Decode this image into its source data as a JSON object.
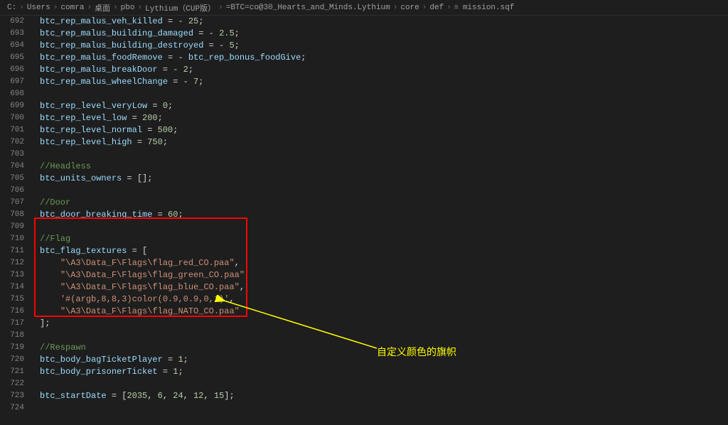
{
  "breadcrumb": {
    "items": [
      "C:",
      "Users",
      "comra",
      "桌面",
      "pbo",
      "Lythium（CUP版）",
      "=BTC=co@30_Hearts_and_Minds.Lythium",
      "core",
      "def",
      "mission.sqf"
    ],
    "file_icon": "≡"
  },
  "lines": [
    {
      "n": 692,
      "tokens": [
        {
          "t": "var",
          "v": "btc_rep_malus_veh_killed"
        },
        {
          "t": "op",
          "v": " = "
        },
        {
          "t": "op",
          "v": "- "
        },
        {
          "t": "num",
          "v": "25"
        },
        {
          "t": "punc",
          "v": ";"
        }
      ]
    },
    {
      "n": 693,
      "tokens": [
        {
          "t": "var",
          "v": "btc_rep_malus_building_damaged"
        },
        {
          "t": "op",
          "v": " = "
        },
        {
          "t": "op",
          "v": "- "
        },
        {
          "t": "num",
          "v": "2.5"
        },
        {
          "t": "punc",
          "v": ";"
        }
      ]
    },
    {
      "n": 694,
      "tokens": [
        {
          "t": "var",
          "v": "btc_rep_malus_building_destroyed"
        },
        {
          "t": "op",
          "v": " = "
        },
        {
          "t": "op",
          "v": "- "
        },
        {
          "t": "num",
          "v": "5"
        },
        {
          "t": "punc",
          "v": ";"
        }
      ]
    },
    {
      "n": 695,
      "tokens": [
        {
          "t": "var",
          "v": "btc_rep_malus_foodRemove"
        },
        {
          "t": "op",
          "v": " = "
        },
        {
          "t": "op",
          "v": "- "
        },
        {
          "t": "var",
          "v": "btc_rep_bonus_foodGive"
        },
        {
          "t": "punc",
          "v": ";"
        }
      ]
    },
    {
      "n": 696,
      "tokens": [
        {
          "t": "var",
          "v": "btc_rep_malus_breakDoor"
        },
        {
          "t": "op",
          "v": " = "
        },
        {
          "t": "op",
          "v": "- "
        },
        {
          "t": "num",
          "v": "2"
        },
        {
          "t": "punc",
          "v": ";"
        }
      ]
    },
    {
      "n": 697,
      "tokens": [
        {
          "t": "var",
          "v": "btc_rep_malus_wheelChange"
        },
        {
          "t": "op",
          "v": " = "
        },
        {
          "t": "op",
          "v": "- "
        },
        {
          "t": "num",
          "v": "7"
        },
        {
          "t": "punc",
          "v": ";"
        }
      ]
    },
    {
      "n": 698,
      "tokens": []
    },
    {
      "n": 699,
      "tokens": [
        {
          "t": "var",
          "v": "btc_rep_level_veryLow"
        },
        {
          "t": "op",
          "v": " = "
        },
        {
          "t": "num",
          "v": "0"
        },
        {
          "t": "punc",
          "v": ";"
        }
      ]
    },
    {
      "n": 700,
      "tokens": [
        {
          "t": "var",
          "v": "btc_rep_level_low"
        },
        {
          "t": "op",
          "v": " = "
        },
        {
          "t": "num",
          "v": "200"
        },
        {
          "t": "punc",
          "v": ";"
        }
      ]
    },
    {
      "n": 701,
      "tokens": [
        {
          "t": "var",
          "v": "btc_rep_level_normal"
        },
        {
          "t": "op",
          "v": " = "
        },
        {
          "t": "num",
          "v": "500"
        },
        {
          "t": "punc",
          "v": ";"
        }
      ]
    },
    {
      "n": 702,
      "tokens": [
        {
          "t": "var",
          "v": "btc_rep_level_high"
        },
        {
          "t": "op",
          "v": " = "
        },
        {
          "t": "num",
          "v": "750"
        },
        {
          "t": "punc",
          "v": ";"
        }
      ]
    },
    {
      "n": 703,
      "tokens": []
    },
    {
      "n": 704,
      "tokens": [
        {
          "t": "comment",
          "v": "//Headless"
        }
      ]
    },
    {
      "n": 705,
      "tokens": [
        {
          "t": "var",
          "v": "btc_units_owners"
        },
        {
          "t": "op",
          "v": " = "
        },
        {
          "t": "punc",
          "v": "[];"
        }
      ]
    },
    {
      "n": 706,
      "tokens": []
    },
    {
      "n": 707,
      "tokens": [
        {
          "t": "comment",
          "v": "//Door"
        }
      ]
    },
    {
      "n": 708,
      "tokens": [
        {
          "t": "var",
          "v": "btc_door_breaking_time"
        },
        {
          "t": "op",
          "v": " = "
        },
        {
          "t": "num",
          "v": "60"
        },
        {
          "t": "punc",
          "v": ";"
        }
      ]
    },
    {
      "n": 709,
      "tokens": []
    },
    {
      "n": 710,
      "tokens": [
        {
          "t": "comment",
          "v": "//Flag"
        }
      ]
    },
    {
      "n": 711,
      "tokens": [
        {
          "t": "var",
          "v": "btc_flag_textures"
        },
        {
          "t": "op",
          "v": " = "
        },
        {
          "t": "punc",
          "v": "["
        }
      ]
    },
    {
      "n": 712,
      "tokens": [
        {
          "t": "indent",
          "v": "    "
        },
        {
          "t": "str",
          "v": "\"\\A3\\Data_F\\Flags\\flag_red_CO.paa\""
        },
        {
          "t": "punc",
          "v": ","
        }
      ]
    },
    {
      "n": 713,
      "tokens": [
        {
          "t": "indent",
          "v": "    "
        },
        {
          "t": "str",
          "v": "\"\\A3\\Data_F\\Flags\\flag_green_CO.paa\""
        },
        {
          "t": "punc",
          "v": ","
        }
      ]
    },
    {
      "n": 714,
      "tokens": [
        {
          "t": "indent",
          "v": "    "
        },
        {
          "t": "str",
          "v": "\"\\A3\\Data_F\\Flags\\flag_blue_CO.paa\""
        },
        {
          "t": "punc",
          "v": ","
        }
      ]
    },
    {
      "n": 715,
      "tokens": [
        {
          "t": "indent",
          "v": "    "
        },
        {
          "t": "str",
          "v": "'#(argb,8,8,3)color(0.9,0.9,0,1)'"
        },
        {
          "t": "punc",
          "v": ","
        }
      ]
    },
    {
      "n": 716,
      "tokens": [
        {
          "t": "indent",
          "v": "    "
        },
        {
          "t": "str",
          "v": "\"\\A3\\Data_F\\Flags\\flag_NATO_CO.paa\""
        }
      ]
    },
    {
      "n": 717,
      "tokens": [
        {
          "t": "punc",
          "v": "];"
        }
      ]
    },
    {
      "n": 718,
      "tokens": []
    },
    {
      "n": 719,
      "tokens": [
        {
          "t": "comment",
          "v": "//Respawn"
        }
      ]
    },
    {
      "n": 720,
      "tokens": [
        {
          "t": "var",
          "v": "btc_body_bagTicketPlayer"
        },
        {
          "t": "op",
          "v": " = "
        },
        {
          "t": "num",
          "v": "1"
        },
        {
          "t": "punc",
          "v": ";"
        }
      ]
    },
    {
      "n": 721,
      "tokens": [
        {
          "t": "var",
          "v": "btc_body_prisonerTicket"
        },
        {
          "t": "op",
          "v": " = "
        },
        {
          "t": "num",
          "v": "1"
        },
        {
          "t": "punc",
          "v": ";"
        }
      ]
    },
    {
      "n": 722,
      "tokens": []
    },
    {
      "n": 723,
      "tokens": [
        {
          "t": "var",
          "v": "btc_startDate"
        },
        {
          "t": "op",
          "v": " = "
        },
        {
          "t": "punc",
          "v": "["
        },
        {
          "t": "num",
          "v": "2035"
        },
        {
          "t": "punc",
          "v": ", "
        },
        {
          "t": "num",
          "v": "6"
        },
        {
          "t": "punc",
          "v": ", "
        },
        {
          "t": "num",
          "v": "24"
        },
        {
          "t": "punc",
          "v": ", "
        },
        {
          "t": "num",
          "v": "12"
        },
        {
          "t": "punc",
          "v": ", "
        },
        {
          "t": "num",
          "v": "15"
        },
        {
          "t": "punc",
          "v": "];"
        }
      ]
    },
    {
      "n": 724,
      "tokens": []
    }
  ],
  "annotation_text": "自定义颜色的旗帜"
}
